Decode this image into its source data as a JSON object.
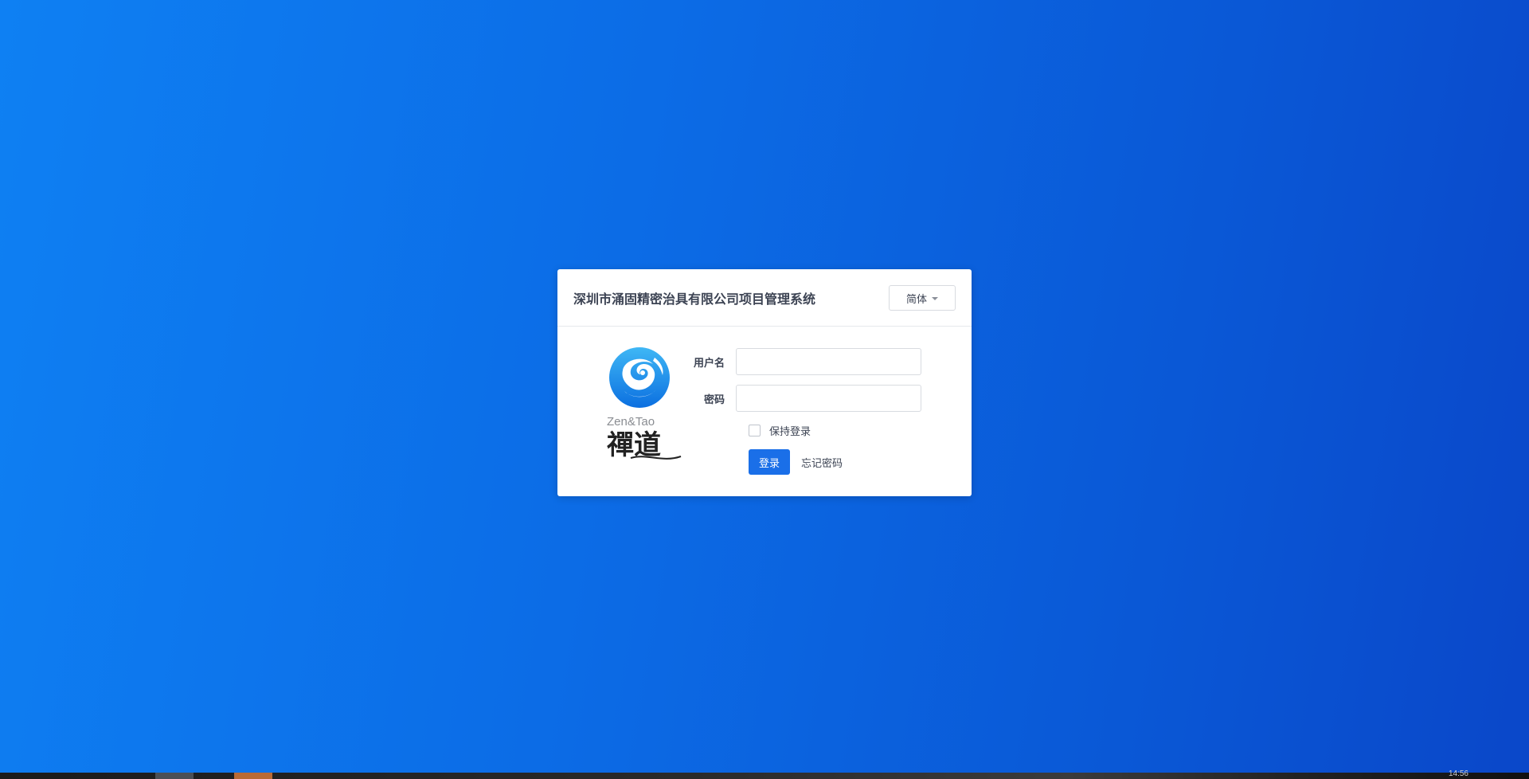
{
  "login": {
    "title": "深圳市涌固精密治具有限公司项目管理系统",
    "language_label": "简体",
    "username_label": "用户名",
    "username_value": "",
    "password_label": "密码",
    "password_value": "",
    "keep_login_label": "保持登录",
    "login_button_label": "登录",
    "forgot_password_label": "忘记密码"
  },
  "logo": {
    "english_text": "Zen&Tao",
    "chinese_text": "禪道",
    "color": "#1a8ae8"
  },
  "taskbar": {
    "time": "14:56"
  },
  "colors": {
    "primary": "#1a6fe8",
    "background_start": "#0e80f3",
    "background_end": "#0a47c9"
  }
}
